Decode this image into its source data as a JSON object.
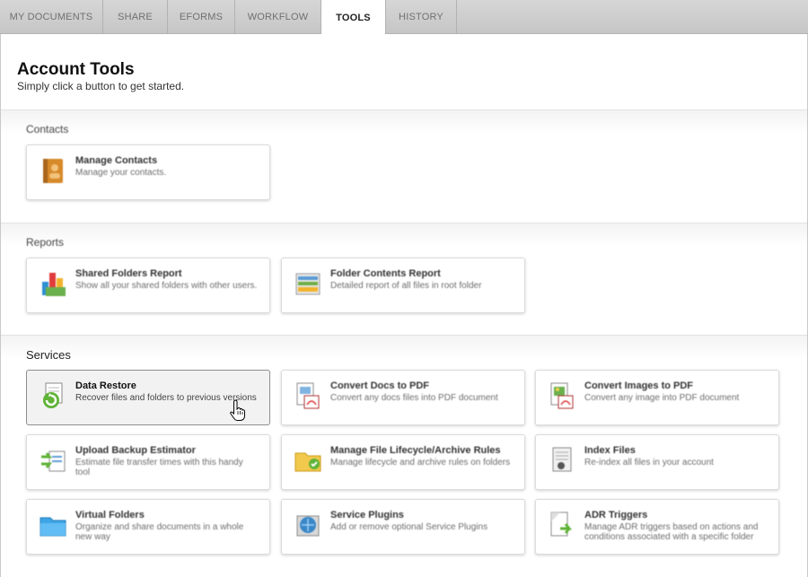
{
  "tabs": [
    {
      "label": "MY DOCUMENTS"
    },
    {
      "label": "SHARE"
    },
    {
      "label": "EFORMS"
    },
    {
      "label": "WORKFLOW"
    },
    {
      "label": "TOOLS",
      "active": true
    },
    {
      "label": "HISTORY"
    }
  ],
  "header": {
    "title": "Account Tools",
    "subtitle": "Simply click a button to get started."
  },
  "sections": [
    {
      "title": "Contacts",
      "cards": [
        {
          "title": "Manage Contacts",
          "desc": "Manage your contacts.",
          "icon": "address-book-icon"
        }
      ]
    },
    {
      "title": "Reports",
      "cards": [
        {
          "title": "Shared Folders Report",
          "desc": "Show all your shared folders with other users.",
          "icon": "shared-folders-report-icon"
        },
        {
          "title": "Folder Contents Report",
          "desc": "Detailed report of all files in root folder",
          "icon": "folder-contents-report-icon"
        }
      ]
    },
    {
      "title": "Services",
      "cards": [
        {
          "title": "Data Restore",
          "desc": "Recover files and folders to previous versions",
          "icon": "data-restore-icon"
        },
        {
          "title": "Convert Docs to PDF",
          "desc": "Convert any docs files into PDF document",
          "icon": "convert-docs-pdf-icon"
        },
        {
          "title": "Convert Images to PDF",
          "desc": "Convert any image into PDF document",
          "icon": "convert-images-pdf-icon"
        },
        {
          "title": "Upload Backup Estimator",
          "desc": "Estimate file transfer times with this handy tool",
          "icon": "upload-estimator-icon"
        },
        {
          "title": "Manage File Lifecycle/Archive Rules",
          "desc": "Manage lifecycle and archive rules on folders",
          "icon": "lifecycle-folder-icon"
        },
        {
          "title": "Index Files",
          "desc": "Re-index all files in your account",
          "icon": "index-files-icon"
        },
        {
          "title": "Virtual Folders",
          "desc": "Organize and share documents in a whole new way",
          "icon": "virtual-folder-icon"
        },
        {
          "title": "Service Plugins",
          "desc": "Add or remove optional Service Plugins",
          "icon": "service-plugins-icon"
        },
        {
          "title": "ADR Triggers",
          "desc": "Manage ADR triggers based on actions and conditions associated with a specific folder",
          "icon": "adr-triggers-icon"
        }
      ]
    }
  ]
}
